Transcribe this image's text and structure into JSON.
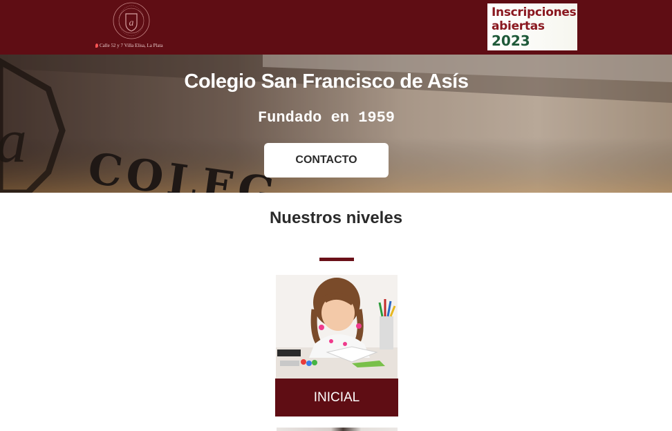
{
  "header": {
    "logo": {
      "seal_text": "Colegio San Francisco de Asís",
      "address": "Calle 52 y 7 Villa Elisa, La Plata"
    },
    "enroll_banner": {
      "line1": "Inscripciones",
      "line2": "abiertas",
      "year": "2023"
    }
  },
  "hero": {
    "title": "Colegio San Francisco de Asís",
    "subtitle": "Fundado en 1959",
    "contact_label": "CONTACTO",
    "background_letters": "COLEG"
  },
  "levels": {
    "title": "Nuestros niveles",
    "items": [
      {
        "label": "INICIAL"
      }
    ]
  },
  "colors": {
    "brand": "#5f0d14",
    "banner_red": "#8a1820",
    "banner_green": "#1f5a3a"
  },
  "icons": [
    "school-seal-logo",
    "pin-icon"
  ]
}
